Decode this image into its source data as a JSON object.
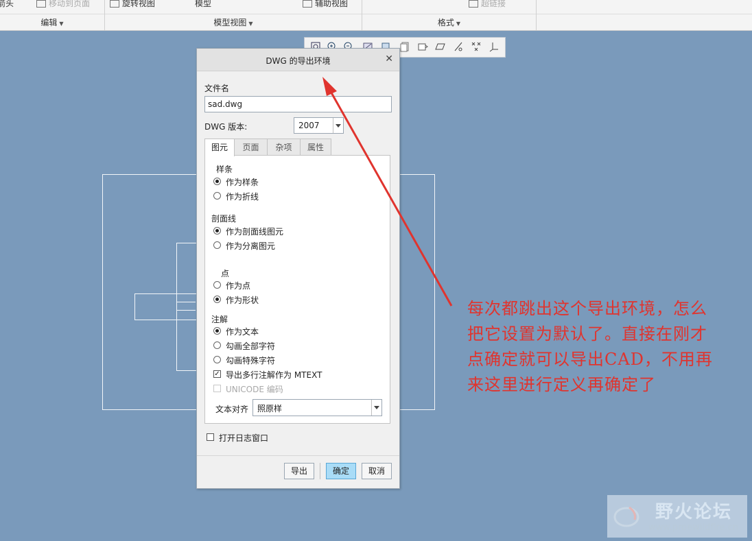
{
  "ribbon": {
    "top_buttons": [
      "箭头",
      "移动到页面",
      "旋转视图",
      "模型",
      "辅助视图",
      "超链接"
    ],
    "groups": [
      "编辑",
      "模型视图",
      "格式"
    ]
  },
  "dialog": {
    "title": "DWG 的导出环境",
    "filename_label": "文件名",
    "filename_value": "sad.dwg",
    "version_label": "DWG 版本:",
    "version_value": "2007",
    "tabs": [
      "图元",
      "页面",
      "杂项",
      "属性"
    ],
    "active_tab": "图元",
    "sections": {
      "spline": {
        "title": "样条",
        "options": [
          {
            "label": "作为样条",
            "selected": true
          },
          {
            "label": "作为折线",
            "selected": false
          }
        ]
      },
      "hatch": {
        "title": "剖面线",
        "options": [
          {
            "label": "作为剖面线图元",
            "selected": true
          },
          {
            "label": "作为分离图元",
            "selected": false
          }
        ]
      },
      "point": {
        "title": "点",
        "options": [
          {
            "label": "作为点",
            "selected": false
          },
          {
            "label": "作为形状",
            "selected": true
          }
        ]
      },
      "note": {
        "title": "注解",
        "options": [
          {
            "label": "作为文本",
            "selected": true
          },
          {
            "label": "勾画全部字符",
            "selected": false
          },
          {
            "label": "勾画特殊字符",
            "selected": false
          }
        ],
        "mtext_label": "导出多行注解作为 MTEXT",
        "mtext_checked": true,
        "unicode_label": "UNICODE 编码",
        "unicode_checked": false
      }
    },
    "align_label": "文本对齐",
    "align_value": "照原样",
    "log_label": "打开日志窗口",
    "log_checked": false,
    "buttons": {
      "export": "导出",
      "ok": "确定",
      "cancel": "取消"
    }
  },
  "annotation": {
    "lines": [
      "每次都跳出这个导出环境，怎么",
      "把它设置为默认了。直接在刚才",
      "点确定就可以导出CAD，不用再",
      "来这里进行定义再确定了"
    ],
    "color": "#e0342e"
  },
  "watermark": {
    "name": "野火论坛",
    "url": "www.proewildfire.cn"
  },
  "colors": {
    "canvas": "#7a9abb",
    "primary_button": "#a9dcf7",
    "annotation": "#e0342e"
  }
}
